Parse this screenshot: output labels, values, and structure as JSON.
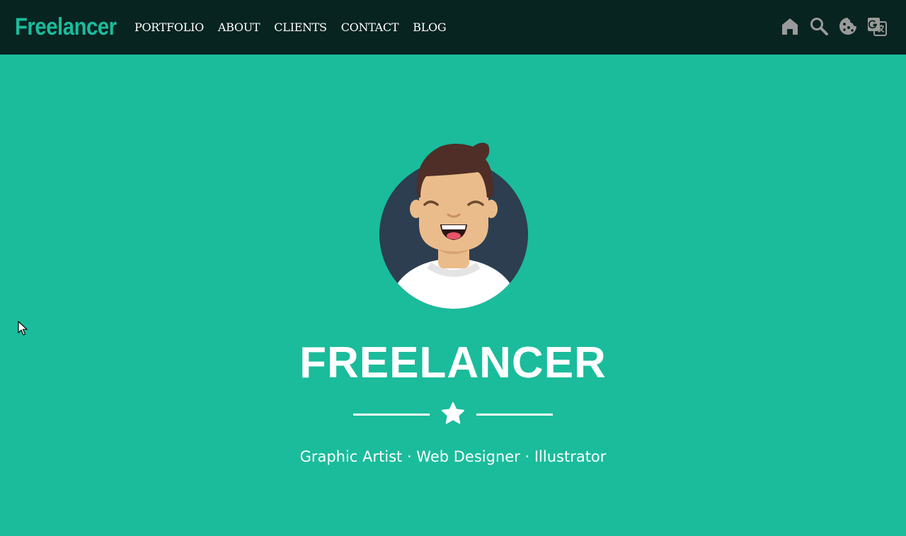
{
  "navbar": {
    "brand": "Freelancer",
    "links": [
      {
        "label": "PORTFOLIO"
      },
      {
        "label": "ABOUT"
      },
      {
        "label": "CLIENTS"
      },
      {
        "label": "CONTACT"
      },
      {
        "label": "BLOG"
      }
    ],
    "icons": [
      "home-icon",
      "search-icon",
      "cookie-icon",
      "translate-icon"
    ]
  },
  "hero": {
    "title": "FREELANCER",
    "subtitle": "Graphic Artist · Web Designer · Illustrator",
    "avatar_icon": "avatar-illustration",
    "divider_icon": "star-icon"
  },
  "colors": {
    "background": "#1abc9c",
    "navbar": "#072420",
    "brand": "#1abc9c",
    "text": "#ffffff",
    "icon_gray": "#9a9a9a"
  }
}
